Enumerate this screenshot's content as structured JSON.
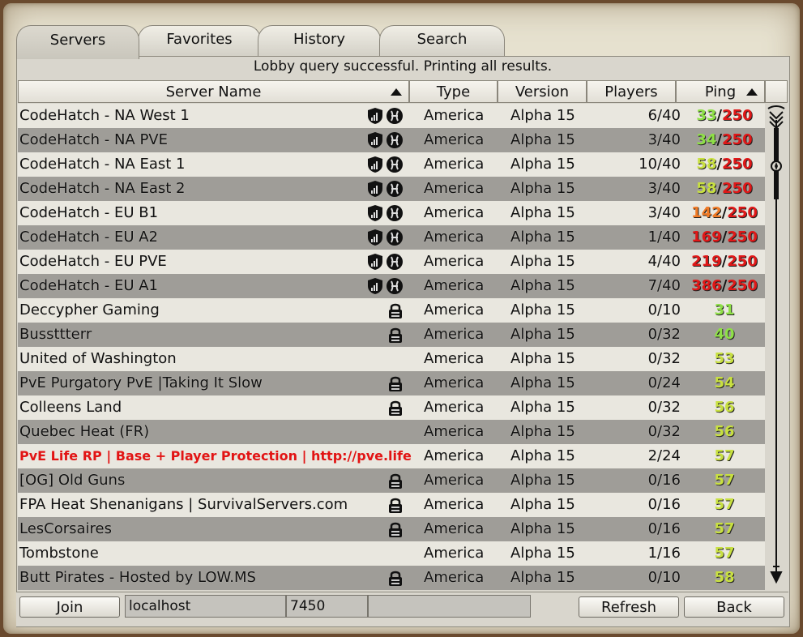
{
  "tabs": [
    {
      "label": "Servers"
    },
    {
      "label": "Favorites"
    },
    {
      "label": "History"
    },
    {
      "label": "Search"
    }
  ],
  "status": "Lobby query successful. Printing all results.",
  "columns": {
    "name": "Server Name",
    "type": "Type",
    "version": "Version",
    "players": "Players",
    "ping": "Ping"
  },
  "rows": [
    {
      "name": "CodeHatch - NA West 1",
      "icon": "shield-hatch",
      "type": "America",
      "version": "Alpha 15",
      "players": "6/40",
      "ping": "33",
      "ping_color": "g",
      "max": "250"
    },
    {
      "name": "CodeHatch - NA PVE",
      "icon": "shield-hatch",
      "type": "America",
      "version": "Alpha 15",
      "players": "3/40",
      "ping": "34",
      "ping_color": "g",
      "max": "250"
    },
    {
      "name": "CodeHatch - NA East 1",
      "icon": "shield-hatch",
      "type": "America",
      "version": "Alpha 15",
      "players": "10/40",
      "ping": "58",
      "ping_color": "y",
      "max": "250"
    },
    {
      "name": "CodeHatch - NA East 2",
      "icon": "shield-hatch",
      "type": "America",
      "version": "Alpha 15",
      "players": "3/40",
      "ping": "58",
      "ping_color": "y",
      "max": "250"
    },
    {
      "name": "CodeHatch - EU B1",
      "icon": "shield-hatch",
      "type": "America",
      "version": "Alpha 15",
      "players": "3/40",
      "ping": "142",
      "ping_color": "o",
      "max": "250"
    },
    {
      "name": "CodeHatch - EU A2",
      "icon": "shield-hatch",
      "type": "America",
      "version": "Alpha 15",
      "players": "1/40",
      "ping": "169",
      "ping_color": "r",
      "max": "250"
    },
    {
      "name": "CodeHatch - EU PVE",
      "icon": "shield-hatch",
      "type": "America",
      "version": "Alpha 15",
      "players": "4/40",
      "ping": "219",
      "ping_color": "r",
      "max": "250"
    },
    {
      "name": "CodeHatch - EU A1",
      "icon": "shield-hatch",
      "type": "America",
      "version": "Alpha 15",
      "players": "7/40",
      "ping": "386",
      "ping_color": "r",
      "max": "250"
    },
    {
      "name": "Deccypher Gaming",
      "icon": "lock",
      "type": "America",
      "version": "Alpha 15",
      "players": "0/10",
      "ping": "31",
      "ping_color": "g",
      "max": ""
    },
    {
      "name": "Bussttterr",
      "icon": "lock",
      "type": "America",
      "version": "Alpha 15",
      "players": "0/32",
      "ping": "40",
      "ping_color": "g",
      "max": ""
    },
    {
      "name": "United of Washington",
      "icon": "",
      "type": "America",
      "version": "Alpha 15",
      "players": "0/32",
      "ping": "53",
      "ping_color": "y",
      "max": ""
    },
    {
      "name": "PvE Purgatory PvE |Taking It Slow",
      "icon": "lock",
      "type": "America",
      "version": "Alpha 15",
      "players": "0/24",
      "ping": "54",
      "ping_color": "y",
      "max": ""
    },
    {
      "name": "Colleens Land",
      "icon": "lock",
      "type": "America",
      "version": "Alpha 15",
      "players": "0/32",
      "ping": "56",
      "ping_color": "y",
      "max": ""
    },
    {
      "name": "Quebec Heat (FR)",
      "icon": "",
      "type": "America",
      "version": "Alpha 15",
      "players": "0/32",
      "ping": "56",
      "ping_color": "y",
      "max": ""
    },
    {
      "name": "PvE Life RP | Base + Player Protection | http://pve.life",
      "icon": "",
      "highlight": true,
      "type": "America",
      "version": "Alpha 15",
      "players": "2/24",
      "ping": "57",
      "ping_color": "y",
      "max": ""
    },
    {
      "name": "[OG] Old Guns",
      "icon": "lock",
      "type": "America",
      "version": "Alpha 15",
      "players": "0/16",
      "ping": "57",
      "ping_color": "y",
      "max": ""
    },
    {
      "name": "FPA Heat Shenanigans | SurvivalServers.com",
      "icon": "lock",
      "type": "America",
      "version": "Alpha 15",
      "players": "0/16",
      "ping": "57",
      "ping_color": "y",
      "max": ""
    },
    {
      "name": "LesCorsaires",
      "icon": "lock",
      "type": "America",
      "version": "Alpha 15",
      "players": "0/16",
      "ping": "57",
      "ping_color": "y",
      "max": ""
    },
    {
      "name": "Tombstone",
      "icon": "",
      "type": "America",
      "version": "Alpha 15",
      "players": "1/16",
      "ping": "57",
      "ping_color": "y",
      "max": ""
    },
    {
      "name": "Butt Pirates - Hosted by LOW.MS",
      "icon": "lock",
      "type": "America",
      "version": "Alpha 15",
      "players": "0/10",
      "ping": "58",
      "ping_color": "y",
      "max": ""
    }
  ],
  "bottom": {
    "join_label": "Join",
    "host_value": "localhost",
    "port_value": "7450",
    "password_value": "",
    "refresh_label": "Refresh",
    "back_label": "Back"
  },
  "colors": {
    "ping_green": "#8ee046",
    "ping_yellow": "#c8e040",
    "ping_orange": "#f07a25",
    "ping_red": "#e01818",
    "highlight_name": "#e21414"
  }
}
